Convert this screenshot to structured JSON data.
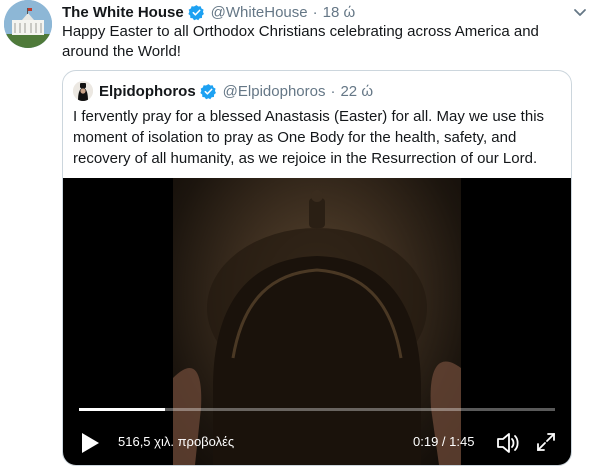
{
  "tweet": {
    "author_name": "The White House",
    "handle": "@WhiteHouse",
    "separator": "·",
    "time": "18 ώ",
    "text": "Happy Easter to all Orthodox Christians celebrating across America and around the World!"
  },
  "quoted_tweet": {
    "author_name": "Elpidophoros",
    "handle": "@Elpidophoros",
    "separator": "·",
    "time": "22 ώ",
    "text": "I fervently pray for a blessed Anastasis (Easter) for all. May we use this moment of isolation to pray as One Body for the health, safety, and recovery of all humanity, as we rejoice in the Resurrection of our Lord."
  },
  "video": {
    "views": "516,5 χιλ. προβολές",
    "elapsed": "0:19",
    "total": "1:45",
    "time_display": "0:19 / 1:45",
    "progress_fraction": 0.181
  },
  "icons": {
    "verified": "verified-badge-icon",
    "more": "chevron-down-icon",
    "play": "play-icon",
    "volume": "volume-muted-icon",
    "fullscreen": "fullscreen-icon"
  },
  "colors": {
    "text": "#14171a",
    "secondary_text": "#657786",
    "verified_blue": "#1da1f2",
    "border": "#ccd6dd"
  }
}
